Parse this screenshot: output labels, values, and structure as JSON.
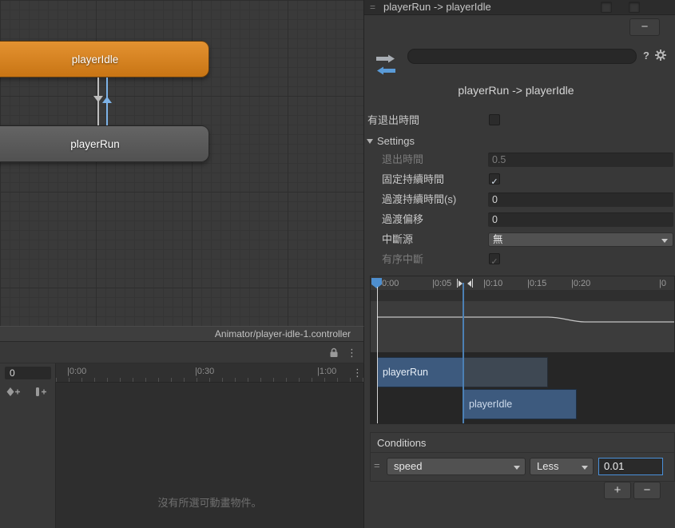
{
  "graph": {
    "nodes": [
      {
        "label": "playerIdle",
        "color": "#d0801f"
      },
      {
        "label": "playerRun",
        "color": "#5a5a5a"
      }
    ],
    "status_bar": "Animator/player-idle-1.controller"
  },
  "animation": {
    "frame_value": "0",
    "ruler": [
      "|0:00",
      "|0:30",
      "|1:00"
    ],
    "empty_message": "沒有所選可動畫物件。"
  },
  "inspector": {
    "transition_row": {
      "title": "playerRun -> playerIdle"
    },
    "title": "playerRun -> playerIdle",
    "name_field": "",
    "has_exit_time_label": "有退出時間",
    "settings_label": "Settings",
    "rows": {
      "exit_time": {
        "label": "退出時間",
        "value": "0.5"
      },
      "fixed_duration": {
        "label": "固定持續時間",
        "checked": true
      },
      "transition_duration": {
        "label": "過渡持續時間(s)",
        "value": "0"
      },
      "transition_offset": {
        "label": "過渡偏移",
        "value": "0"
      },
      "interruption_source": {
        "label": "中斷源",
        "value": "無"
      },
      "ordered_interruption": {
        "label": "有序中斷",
        "checked": true
      }
    },
    "timeline": {
      "ruler": [
        "0:00",
        "|0:05",
        "|0:10",
        "|0:15",
        "|0:20",
        "|0"
      ],
      "bars": [
        {
          "label": "playerRun"
        },
        {
          "label": "playerIdle"
        }
      ]
    },
    "conditions": {
      "title": "Conditions",
      "row": {
        "parameter": "speed",
        "operator": "Less",
        "value": "0.01"
      }
    }
  },
  "icons": {
    "kebab": "⋮",
    "help": "?",
    "check": "✓",
    "plus": "+",
    "minus": "−",
    "handle": "="
  },
  "colors": {
    "state_default_orange": "#d0801f",
    "timeline_blue": "#3d5a7e",
    "focus_blue": "#4a90d9"
  }
}
